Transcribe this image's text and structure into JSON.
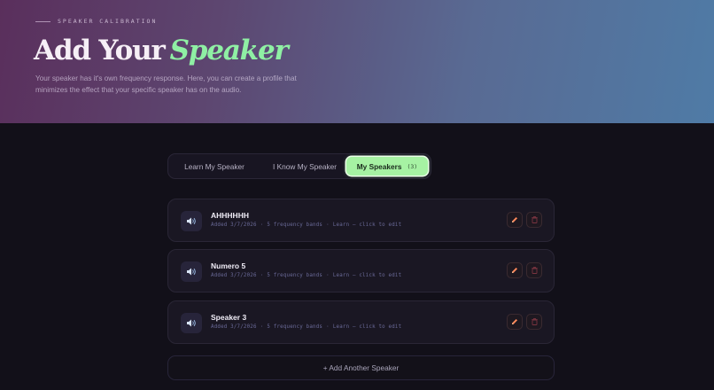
{
  "header": {
    "eyebrow": "SPEAKER CALIBRATION",
    "title_main": "Add Your",
    "title_accent": "Speaker",
    "subtitle": "Your speaker has it's own frequency response. Here, you can create a profile that minimizes the effect that your specific speaker has on the audio."
  },
  "tabs": [
    {
      "label": "Learn My Speaker"
    },
    {
      "label": "I Know My Speaker"
    },
    {
      "label": "My Speakers",
      "count": "(3)",
      "active": true
    }
  ],
  "speakers": [
    {
      "name": "AHHHHHH",
      "added": "Added 3/7/2026",
      "bands": "5 frequency bands",
      "mode": "Learn — click to edit"
    },
    {
      "name": "Numero 5",
      "added": "Added 3/7/2026",
      "bands": "5 frequency bands",
      "mode": "Learn — click to edit"
    },
    {
      "name": "Speaker 3",
      "added": "Added 3/7/2026",
      "bands": "5 frequency bands",
      "mode": "Learn — click to edit"
    }
  ],
  "add_button": "+ Add Another Speaker",
  "icons": {
    "speaker": "speaker-icon",
    "edit": "pencil-icon",
    "delete": "trash-icon"
  },
  "colors": {
    "accent": "#a6f2a3",
    "title_accent": "#8ff0a4",
    "edit": "#ff8a5c",
    "delete": "#7a3440",
    "background": "#121019"
  }
}
